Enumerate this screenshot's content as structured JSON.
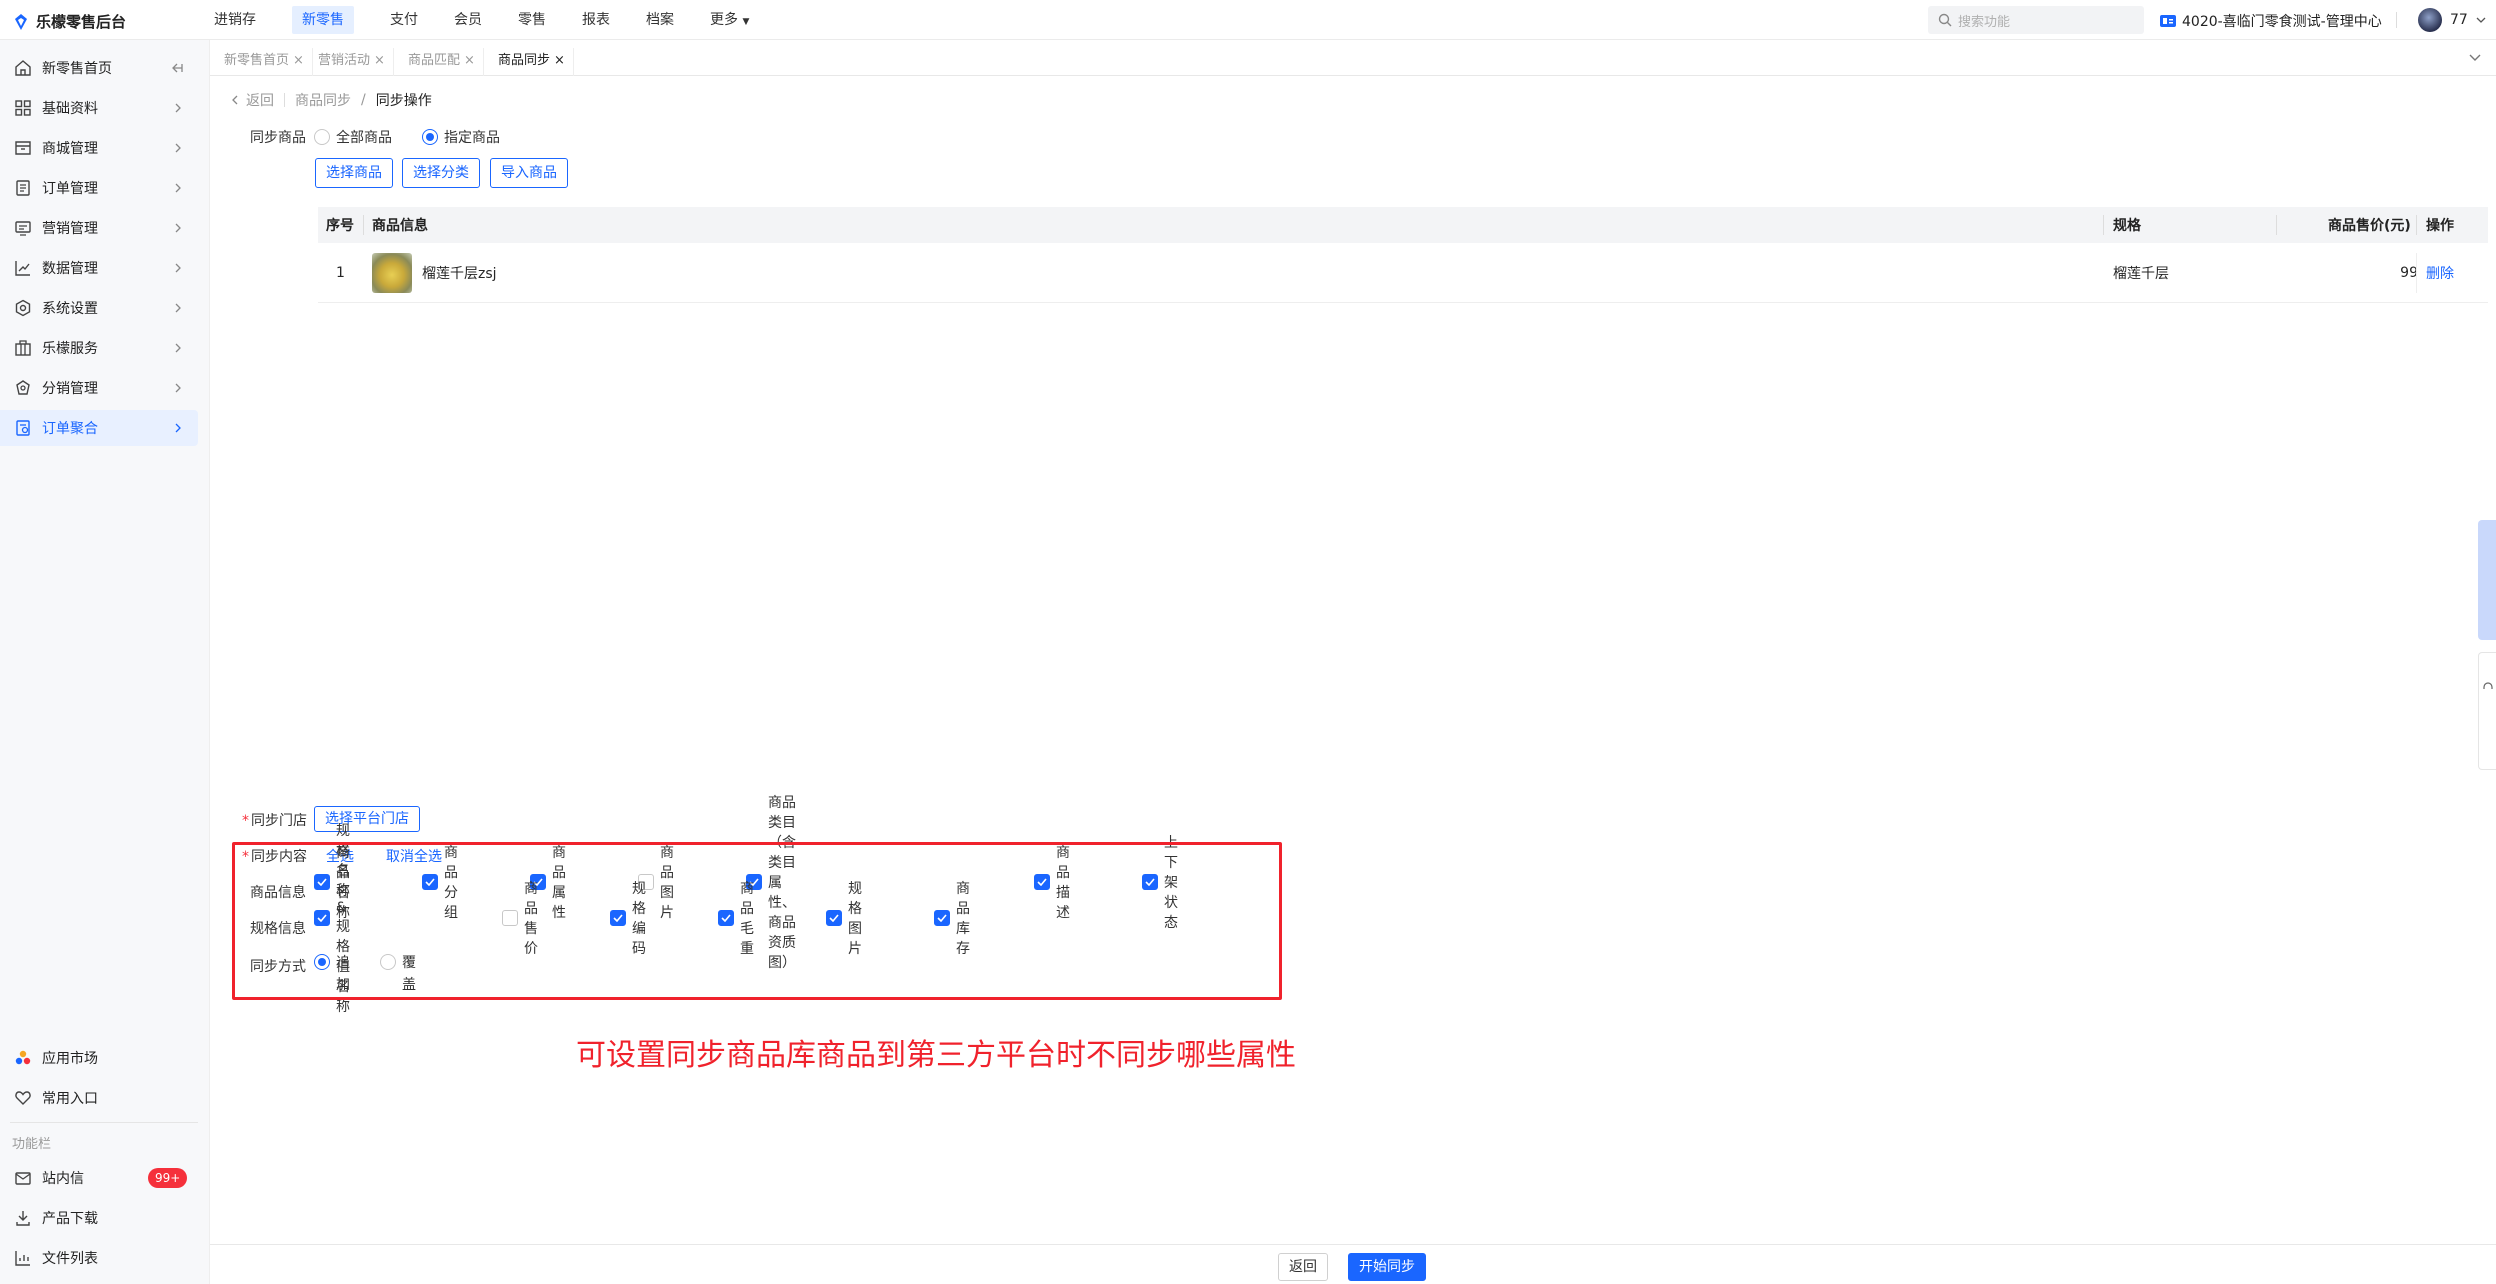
{
  "app": {
    "logo_text": "乐檬零售后台"
  },
  "topnav": {
    "items": [
      "进销存",
      "新零售",
      "支付",
      "会员",
      "零售",
      "报表",
      "档案",
      "更多"
    ],
    "active_index": 1
  },
  "search": {
    "placeholder": "搜索功能"
  },
  "store": {
    "name": "4020-喜临门零食测试-管理中心"
  },
  "user": {
    "name": "77"
  },
  "sidebar": {
    "items": [
      {
        "label": "新零售首页",
        "icon": "home-icon"
      },
      {
        "label": "基础资料",
        "icon": "grid-icon"
      },
      {
        "label": "商城管理",
        "icon": "shop-icon"
      },
      {
        "label": "订单管理",
        "icon": "order-icon"
      },
      {
        "label": "营销管理",
        "icon": "marketing-icon"
      },
      {
        "label": "数据管理",
        "icon": "chart-icon"
      },
      {
        "label": "系统设置",
        "icon": "settings-icon"
      },
      {
        "label": "乐檬服务",
        "icon": "service-icon"
      },
      {
        "label": "分销管理",
        "icon": "distribution-icon"
      },
      {
        "label": "订单聚合",
        "icon": "aggregate-icon"
      }
    ],
    "active_index": 9,
    "bottom_items": [
      {
        "label": "应用市场",
        "icon": "app-market-icon"
      },
      {
        "label": "常用入口",
        "icon": "heart-icon"
      }
    ],
    "section_label": "功能栏",
    "function_items": [
      {
        "label": "站内信",
        "icon": "mail-icon",
        "badge": "99+"
      },
      {
        "label": "产品下载",
        "icon": "download-icon"
      },
      {
        "label": "文件列表",
        "icon": "file-list-icon"
      }
    ]
  },
  "tabs": [
    {
      "label": "新零售首页",
      "active": false
    },
    {
      "label": "营销活动",
      "active": false
    },
    {
      "label": "商品匹配",
      "active": false
    },
    {
      "label": "商品同步",
      "active": true
    }
  ],
  "breadcrumb": {
    "back": "返回",
    "parent": "商品同步",
    "current": "同步操作"
  },
  "sync_goods": {
    "label": "同步商品",
    "options": [
      "全部商品",
      "指定商品"
    ],
    "selected_index": 1,
    "buttons": [
      "选择商品",
      "选择分类",
      "导入商品"
    ]
  },
  "table": {
    "headers": [
      "序号",
      "商品信息",
      "规格",
      "商品售价(元)",
      "操作"
    ],
    "rows": [
      {
        "index": "1",
        "name": "榴莲千层zsj",
        "spec": "榴莲千层",
        "price": "99",
        "action": "删除"
      }
    ]
  },
  "sync_store": {
    "label": "同步门店",
    "button": "选择平台门店"
  },
  "sync_content": {
    "label": "同步内容",
    "select_all": "全选",
    "deselect_all": "取消全选",
    "goods_info": {
      "label": "商品信息",
      "items": [
        {
          "label": "商品名称",
          "checked": true
        },
        {
          "label": "商品分组",
          "checked": true
        },
        {
          "label": "商品属性",
          "checked": true
        },
        {
          "label": "商品图片",
          "checked": false
        },
        {
          "label": "商品类目（含类目属性、商品资质图）",
          "checked": true
        },
        {
          "label": "商品描述",
          "checked": true
        },
        {
          "label": "上下架状态",
          "checked": true
        }
      ]
    },
    "spec_info": {
      "label": "规格信息",
      "items": [
        {
          "label": "规格名称&规格值名称",
          "checked": true
        },
        {
          "label": "商品售价",
          "checked": false
        },
        {
          "label": "规格编码",
          "checked": true
        },
        {
          "label": "商品毛重",
          "checked": true
        },
        {
          "label": "规格图片",
          "checked": true
        },
        {
          "label": "商品库存",
          "checked": true
        }
      ]
    }
  },
  "sync_mode": {
    "label": "同步方式",
    "options": [
      [
        "追",
        "加"
      ],
      [
        "覆",
        "盖"
      ]
    ],
    "selected_index": 0
  },
  "annotation": "可设置同步商品库商品到第三方平台时不同步哪些属性",
  "footer": {
    "back": "返回",
    "start": "开始同步"
  },
  "colors": {
    "primary": "#1a66ff",
    "annotation_red": "#f0222c",
    "badge_red": "#f5303b"
  }
}
